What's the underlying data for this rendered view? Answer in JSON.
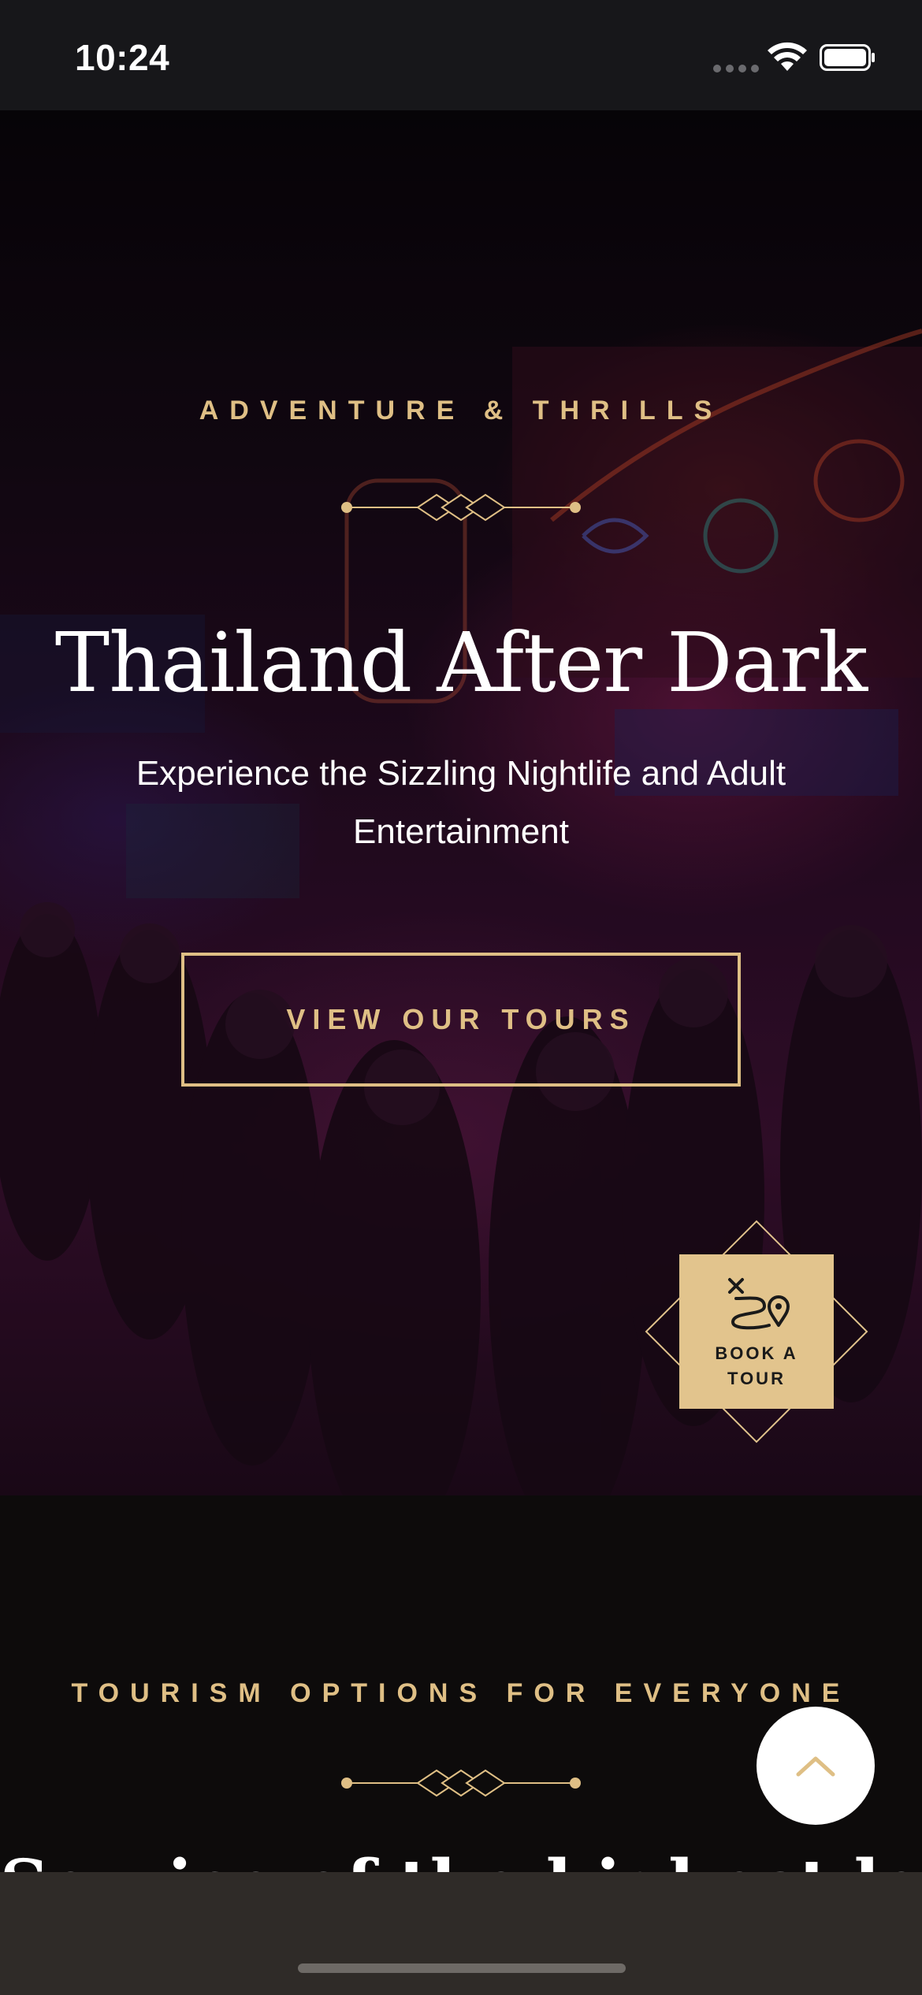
{
  "status_bar": {
    "time": "10:24"
  },
  "hero": {
    "eyebrow": "ADVENTURE & THRILLS",
    "title": "Thailand After Dark",
    "subtitle": "Experience the Sizzling Nightlife and Adult Entertainment",
    "cta_label": "VIEW OUR TOURS",
    "book_label": "BOOK A TOUR",
    "book_icon": "route-map-icon"
  },
  "section": {
    "eyebrow": "TOURISM OPTIONS FOR EVERYONE",
    "heading": "Service of the highest level"
  },
  "scroll_top": {
    "icon": "chevron-up-icon"
  },
  "colors": {
    "accent": "#dfbf85",
    "button_fill": "#e2c48d",
    "background": "#0d0b0b",
    "bottom_bar": "#2f2b28"
  }
}
